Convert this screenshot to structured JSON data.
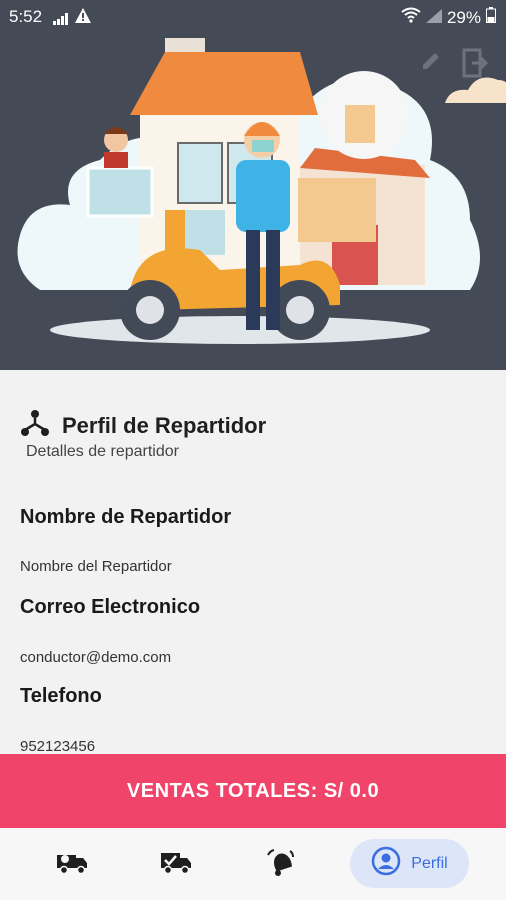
{
  "status": {
    "time": "5:52",
    "battery": "29%"
  },
  "profile": {
    "title": "Perfil de Repartidor",
    "subtitle": "Detalles de repartidor"
  },
  "fields": [
    {
      "label": "Nombre de Repartidor",
      "value": "Nombre del Repartidor"
    },
    {
      "label": "Correo Electronico",
      "value": "conductor@demo.com"
    },
    {
      "label": "Telefono",
      "value": "952123456"
    }
  ],
  "sales": {
    "label": "VENTAS TOTALES: S/ 0.0"
  },
  "nav": {
    "active_label": "Perfil",
    "items": [
      "delivery-truck-icon",
      "truck-check-icon",
      "bell-icon",
      "profile-icon"
    ]
  },
  "colors": {
    "accent": "#f0446b",
    "header_bg": "#454a57",
    "nav_active_bg": "#dde5f8",
    "nav_active_text": "#3a6ee0"
  }
}
